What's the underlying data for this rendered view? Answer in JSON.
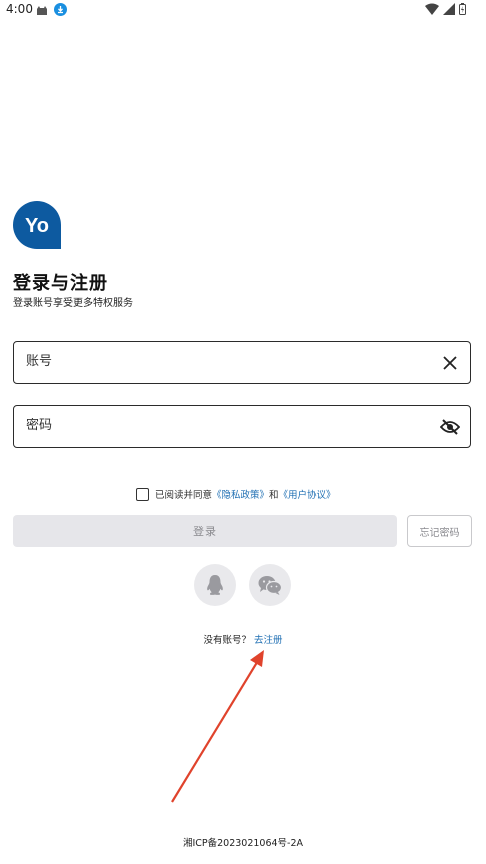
{
  "status_bar": {
    "time": "4:00"
  },
  "logo": {
    "text": "Yo",
    "color": "#0d5aa0"
  },
  "header": {
    "title": "登录与注册",
    "subtitle": "登录账号享受更多特权服务"
  },
  "form": {
    "account_placeholder": "账号",
    "password_placeholder": "密码"
  },
  "agreement": {
    "prefix": "已阅读并同意",
    "privacy_link": "《隐私政策》",
    "and": "和",
    "terms_link": "《用户协议》"
  },
  "buttons": {
    "login": "登录",
    "forgot_password": "忘记密码"
  },
  "register": {
    "question": "没有账号？",
    "link": "去注册"
  },
  "footer": {
    "icp": "湘ICP备2023021064号-2A"
  },
  "colors": {
    "accent": "#1f6fb3",
    "annotation_arrow": "#e0432c"
  }
}
